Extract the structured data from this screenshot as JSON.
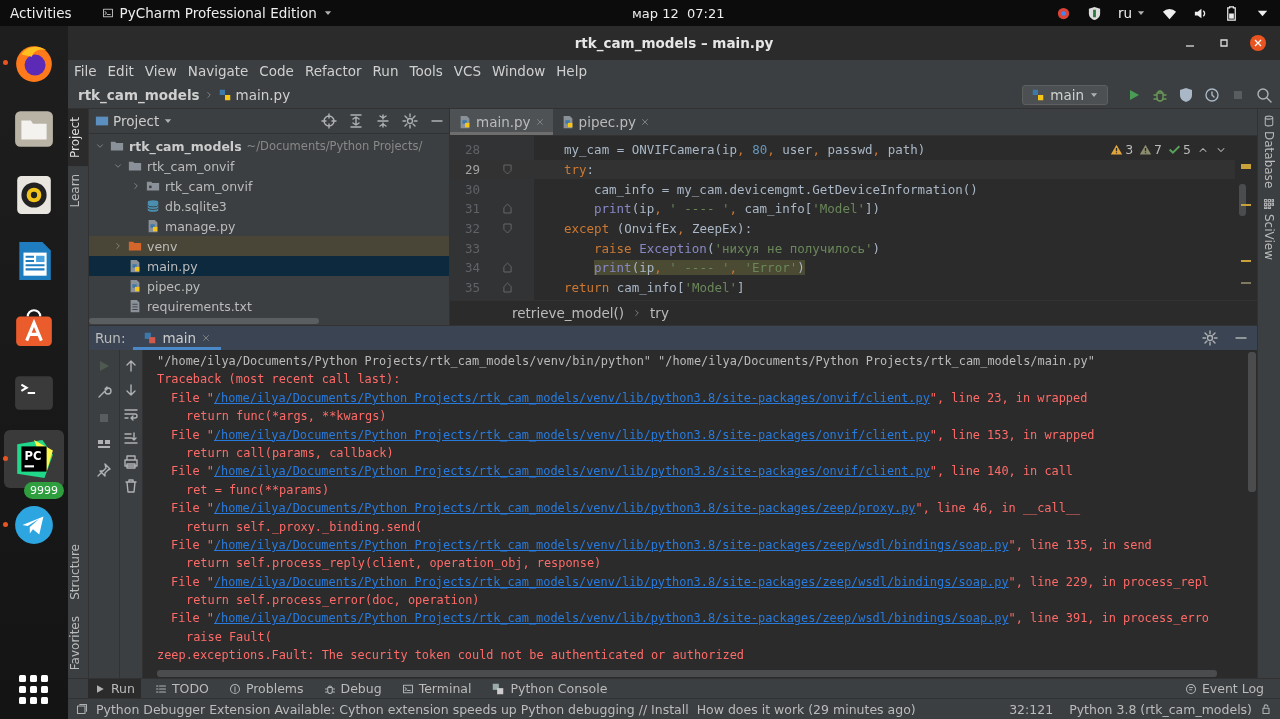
{
  "top_bar": {
    "activities": "Activities",
    "app_menu": "PyCharm Professional Edition",
    "clock": "мар 12  07:21",
    "language": "ru"
  },
  "dock": {
    "items": [
      {
        "running": true,
        "selected": false
      },
      {
        "running": false,
        "selected": false
      },
      {
        "running": false,
        "selected": false
      },
      {
        "running": false,
        "selected": false
      },
      {
        "running": false,
        "selected": false
      },
      {
        "running": false,
        "selected": false
      },
      {
        "running": true,
        "selected": true,
        "logo": "PC"
      },
      {
        "running": true,
        "selected": false,
        "badge": "9999"
      }
    ]
  },
  "window": {
    "title": "rtk_cam_models – main.py"
  },
  "menu": [
    "File",
    "Edit",
    "View",
    "Navigate",
    "Code",
    "Refactor",
    "Run",
    "Tools",
    "VCS",
    "Window",
    "Help"
  ],
  "nav": {
    "breadcrumbs": [
      "rtk_cam_models",
      "main.py"
    ],
    "run_config": "main",
    "actions": [
      {
        "disabled": false
      },
      {
        "disabled": false
      },
      {
        "disabled": false
      },
      {
        "disabled": false
      },
      {
        "disabled": true
      }
    ]
  },
  "left_tools": [
    {
      "label": "Project",
      "selected": true
    },
    {
      "label": "Learn",
      "selected": false
    }
  ],
  "left_tools_bottom": [
    {
      "label": "Structure",
      "selected": false
    },
    {
      "label": "Favorites",
      "selected": false
    }
  ],
  "right_tools": [
    {
      "label": "Database"
    },
    {
      "label": "SciView"
    }
  ],
  "project": {
    "title": "Project",
    "tree": [
      {
        "label": "rtk_cam_models",
        "hint": "~/Documents/Python Projects/",
        "kind": "root",
        "expanded": true,
        "selected": false,
        "children": [
          {
            "label": "rtk_cam_onvif",
            "kind": "folder",
            "expanded": true,
            "selected": false,
            "children": [
              {
                "label": "rtk_cam_onvif",
                "kind": "package",
                "expanded": false,
                "selected": false
              },
              {
                "label": "db.sqlite3",
                "kind": "database",
                "selected": false
              },
              {
                "label": "manage.py",
                "kind": "python",
                "selected": false
              }
            ]
          },
          {
            "label": "venv",
            "kind": "excluded",
            "expanded": false,
            "selected": false
          },
          {
            "label": "main.py",
            "kind": "python",
            "selected": true
          },
          {
            "label": "pipec.py",
            "kind": "python",
            "selected": false
          },
          {
            "label": "requirements.txt",
            "kind": "text",
            "selected": false
          }
        ]
      }
    ]
  },
  "editor": {
    "tabs": [
      {
        "label": "main.py",
        "selected": true
      },
      {
        "label": "pipec.py",
        "selected": false
      }
    ],
    "inspections": [
      {
        "kind": "warning",
        "count": "3"
      },
      {
        "kind": "weak",
        "count": "7"
      },
      {
        "kind": "typo",
        "count": "5"
      }
    ],
    "lines": [
      {
        "no": "28",
        "kind": "outer",
        "current": false,
        "highlighted": false,
        "tokens": [
          {
            "t": "my_cam = ONVIFCamera(ip",
            "kind": "plain"
          },
          {
            "t": ",",
            "kind": "keyword"
          },
          {
            "t": " 80",
            "kind": "number"
          },
          {
            "t": ",",
            "kind": "keyword"
          },
          {
            "t": " user",
            "kind": "plain"
          },
          {
            "t": ",",
            "kind": "keyword"
          },
          {
            "t": " passwd",
            "kind": "plain"
          },
          {
            "t": ",",
            "kind": "keyword"
          },
          {
            "t": " path)",
            "kind": "plain"
          }
        ]
      },
      {
        "no": "29",
        "kind": "outer",
        "current": true,
        "highlighted": false,
        "fold_start": true,
        "tokens": [
          {
            "t": "try",
            "kind": "keyword"
          },
          {
            "t": ":",
            "kind": "plain"
          }
        ]
      },
      {
        "no": "30",
        "kind": "inner",
        "current": false,
        "highlighted": false,
        "tokens": [
          {
            "t": "cam_info = my_cam.devicemgmt.GetDeviceInformation()",
            "kind": "plain"
          }
        ]
      },
      {
        "no": "31",
        "kind": "inner",
        "current": false,
        "highlighted": false,
        "fold_end": true,
        "tokens": [
          {
            "t": "print",
            "kind": "builtin"
          },
          {
            "t": "(ip",
            "kind": "plain"
          },
          {
            "t": ",",
            "kind": "keyword"
          },
          {
            "t": " ' ---- '",
            "kind": "string"
          },
          {
            "t": ",",
            "kind": "keyword"
          },
          {
            "t": " cam_info[",
            "kind": "plain"
          },
          {
            "t": "'Model'",
            "kind": "string"
          },
          {
            "t": "])",
            "kind": "plain"
          }
        ]
      },
      {
        "no": "32",
        "kind": "outer",
        "current": false,
        "highlighted": false,
        "fold_start": true,
        "tokens": [
          {
            "t": "except",
            "kind": "keyword"
          },
          {
            "t": " (OnvifEx",
            "kind": "plain"
          },
          {
            "t": ",",
            "kind": "keyword"
          },
          {
            "t": " ZeepEx):",
            "kind": "plain"
          }
        ]
      },
      {
        "no": "33",
        "kind": "inner",
        "current": false,
        "highlighted": false,
        "tokens": [
          {
            "t": "raise",
            "kind": "keyword"
          },
          {
            "t": " Exception",
            "kind": "builtin"
          },
          {
            "t": "(",
            "kind": "plain"
          },
          {
            "t": "'нихуя не получилось'",
            "kind": "string"
          },
          {
            "t": ")",
            "kind": "plain"
          }
        ]
      },
      {
        "no": "34",
        "kind": "inner",
        "current": false,
        "highlighted": true,
        "fold_end": true,
        "tokens": [
          {
            "t": "print",
            "kind": "builtin"
          },
          {
            "t": "(ip",
            "kind": "plain"
          },
          {
            "t": ",",
            "kind": "keyword"
          },
          {
            "t": " ' ---- '",
            "kind": "string"
          },
          {
            "t": ",",
            "kind": "keyword"
          },
          {
            "t": " 'Error'",
            "kind": "string"
          },
          {
            "t": ")",
            "kind": "plain"
          }
        ]
      },
      {
        "no": "35",
        "kind": "outer",
        "current": false,
        "highlighted": false,
        "fold_end": true,
        "tokens": [
          {
            "t": "return",
            "kind": "keyword"
          },
          {
            "t": " cam_info[",
            "kind": "plain"
          },
          {
            "t": "'Model'",
            "kind": "string"
          },
          {
            "t": "]",
            "kind": "plain"
          }
        ]
      }
    ],
    "breadcrumbs": [
      "retrieve_model()",
      "try"
    ]
  },
  "run": {
    "label": "Run:",
    "tab": "main",
    "toolbar": [
      {
        "disabled": true
      },
      {
        "disabled": false
      },
      {
        "disabled": true
      },
      {
        "disabled": false
      },
      {
        "disabled": false
      }
    ],
    "console": [
      {
        "kind": "cmd",
        "text": "\"/home/ilya/Documents/Python Projects/rtk_cam_models/venv/bin/python\" \"/home/ilya/Documents/Python Projects/rtk_cam_models/main.py\""
      },
      {
        "kind": "error",
        "text": "Traceback (most recent call last):"
      },
      {
        "kind": "frame",
        "before": "File \"",
        "link": "/home/ilya/Documents/Python Projects/rtk_cam_models/venv/lib/python3.8/site-packages/onvif/client.py",
        "after": "\", line 23, in wrapped"
      },
      {
        "kind": "code",
        "text": "return func(*args, **kwargs)"
      },
      {
        "kind": "frame",
        "before": "File \"",
        "link": "/home/ilya/Documents/Python Projects/rtk_cam_models/venv/lib/python3.8/site-packages/onvif/client.py",
        "after": "\", line 153, in wrapped"
      },
      {
        "kind": "code",
        "text": "return call(params, callback)"
      },
      {
        "kind": "frame",
        "before": "File \"",
        "link": "/home/ilya/Documents/Python Projects/rtk_cam_models/venv/lib/python3.8/site-packages/onvif/client.py",
        "after": "\", line 140, in call"
      },
      {
        "kind": "code",
        "text": "ret = func(**params)"
      },
      {
        "kind": "frame",
        "before": "File \"",
        "link": "/home/ilya/Documents/Python Projects/rtk_cam_models/venv/lib/python3.8/site-packages/zeep/proxy.py",
        "after": "\", line 46, in __call__"
      },
      {
        "kind": "code",
        "text": "return self._proxy._binding.send("
      },
      {
        "kind": "frame",
        "before": "File \"",
        "link": "/home/ilya/Documents/Python Projects/rtk_cam_models/venv/lib/python3.8/site-packages/zeep/wsdl/bindings/soap.py",
        "after": "\", line 135, in send"
      },
      {
        "kind": "code",
        "text": "return self.process_reply(client, operation_obj, response)"
      },
      {
        "kind": "frame",
        "before": "File \"",
        "link": "/home/ilya/Documents/Python Projects/rtk_cam_models/venv/lib/python3.8/site-packages/zeep/wsdl/bindings/soap.py",
        "after": "\", line 229, in process_repl"
      },
      {
        "kind": "code",
        "text": "return self.process_error(doc, operation)"
      },
      {
        "kind": "frame",
        "before": "File \"",
        "link": "/home/ilya/Documents/Python Projects/rtk_cam_models/venv/lib/python3.8/site-packages/zeep/wsdl/bindings/soap.py",
        "after": "\", line 391, in process_erro"
      },
      {
        "kind": "code",
        "text": "raise Fault("
      },
      {
        "kind": "error",
        "text": "zeep.exceptions.Fault: The security token could not be authenticated or authorized"
      }
    ]
  },
  "bottom_tabs": [
    {
      "label": "Run",
      "selected": true
    },
    {
      "label": "TODO",
      "selected": false
    },
    {
      "label": "Problems",
      "selected": false
    },
    {
      "label": "Debug",
      "selected": false
    },
    {
      "label": "Terminal",
      "selected": false
    },
    {
      "label": "Python Console",
      "selected": false
    }
  ],
  "event_log": "Event Log",
  "status_bar": {
    "message": "Python Debugger Extension Available: Cython extension speeds up Python debugging // Install  How does it work (29 minutes ago)",
    "position": "32:121",
    "interpreter": "Python 3.8 (rtk_cam_models)"
  }
}
